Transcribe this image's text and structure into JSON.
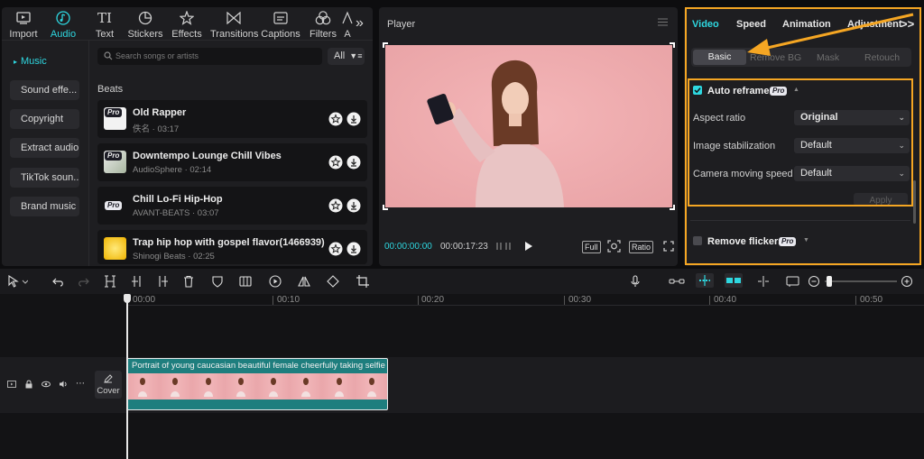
{
  "toolbar": {
    "tools": [
      {
        "label": "Import",
        "icon": "import-icon"
      },
      {
        "label": "Audio",
        "icon": "audio-icon"
      },
      {
        "label": "Text",
        "icon": "text-icon"
      },
      {
        "label": "Stickers",
        "icon": "stickers-icon"
      },
      {
        "label": "Effects",
        "icon": "effects-icon"
      },
      {
        "label": "Transitions",
        "icon": "transitions-icon"
      },
      {
        "label": "Captions",
        "icon": "captions-icon"
      },
      {
        "label": "Filters",
        "icon": "filters-icon"
      },
      {
        "label": "A",
        "icon": "adjust-icon"
      }
    ],
    "more": "»",
    "active_color": "#2ed7e0"
  },
  "audio": {
    "categories": [
      "Music",
      "Sound effe...",
      "Copyright",
      "Extract audio",
      "TikTok soun...",
      "Brand music"
    ],
    "active_category": "Music",
    "search_placeholder": "Search songs or artists",
    "filter_label": "All",
    "section": "Beats",
    "tracks": [
      {
        "title": "Old Rapper",
        "meta": "佚名 · 03:17",
        "pro": "Pro"
      },
      {
        "title": "Downtempo Lounge Chill Vibes",
        "meta": "AudioSphere · 02:14",
        "pro": "Pro"
      },
      {
        "title": "Chill Lo-Fi Hip-Hop",
        "meta": "AVANT-BEATS · 03:07",
        "pro": "Pro"
      },
      {
        "title": "Trap hip hop with gospel flavor(1466939)",
        "meta": "Shinogi Beats · 02:25",
        "pro": ""
      }
    ]
  },
  "player": {
    "title": "Player",
    "current_time": "00:00:00:00",
    "total_time": "00:00:17:23",
    "full_label": "Full",
    "ratio_label": "Ratio"
  },
  "inspector": {
    "tabs": [
      "Video",
      "Speed",
      "Animation",
      "Adjustment"
    ],
    "active_tab": "Video",
    "more": ">>",
    "subtabs": [
      "Basic",
      "Remove BG",
      "Mask",
      "Retouch"
    ],
    "active_subtab": "Basic",
    "auto_reframe": {
      "label": "Auto reframe",
      "pro": "Pro",
      "checked": true
    },
    "rows": [
      {
        "label": "Aspect ratio",
        "value": "Original"
      },
      {
        "label": "Image stabilization",
        "value": "Default"
      },
      {
        "label": "Camera moving speed",
        "value": "Default"
      }
    ],
    "apply_label": "Apply",
    "remove_flickers": {
      "label": "Remove flickers",
      "pro": "Pro",
      "checked": false
    },
    "highlight_color": "#f5a623"
  },
  "timeline": {
    "ticks": [
      "00:00",
      "00:10",
      "00:20",
      "00:30",
      "00:40",
      "00:50"
    ],
    "clip_title": "Portrait of young caucasian beautiful female cheerfully taking selfie",
    "cover_label": "Cover",
    "clip_color": "#1e7e7e"
  }
}
